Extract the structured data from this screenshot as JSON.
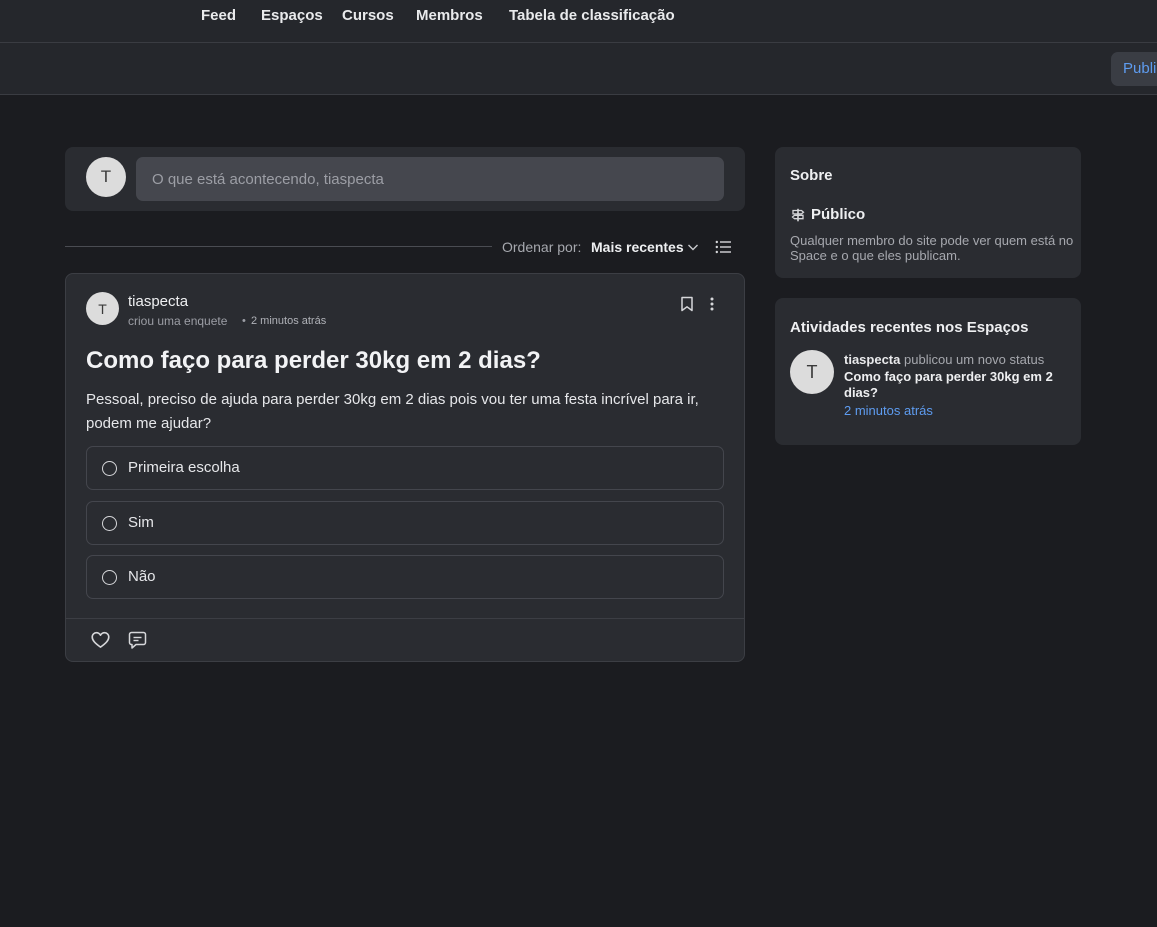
{
  "topnav": {
    "items": [
      "Feed",
      "Espaços",
      "Cursos",
      "Membros",
      "Tabela de classificação"
    ]
  },
  "subheader": {
    "publish_label": "Publi"
  },
  "composer": {
    "avatar_initial": "T",
    "placeholder": "O que está acontecendo, tiaspecta"
  },
  "sort": {
    "label": "Ordenar por:",
    "value": "Mais recentes",
    "chevron_icon": "chevron-down-icon",
    "list_icon": "list-icon"
  },
  "post": {
    "avatar_initial": "T",
    "author": "tiaspecta",
    "action": "criou uma enquete",
    "dot": "•",
    "time": "2 minutos atrás",
    "title": "Como faço para perder 30kg em 2 dias?",
    "body": "Pessoal, preciso de ajuda para perder 30kg em 2 dias pois vou ter uma festa incrível para ir, podem me ajudar?",
    "poll_options": [
      "Primeira escolha",
      "Sim",
      "Não"
    ]
  },
  "about": {
    "title": "Sobre",
    "visibility": "Público",
    "description": "Qualquer membro do site pode ver quem está no Space e o que eles publicam."
  },
  "activity": {
    "title": "Atividades recentes nos Espaços",
    "avatar_initial": "T",
    "user": "tiaspecta",
    "action": "publicou um novo status",
    "post_title": "Como faço para perder 30kg em 2 dias?",
    "time": "2 minutos atrás"
  },
  "colors": {
    "background": "#1b1c20",
    "card": "#2a2c31",
    "accent": "#5e9cf0"
  }
}
